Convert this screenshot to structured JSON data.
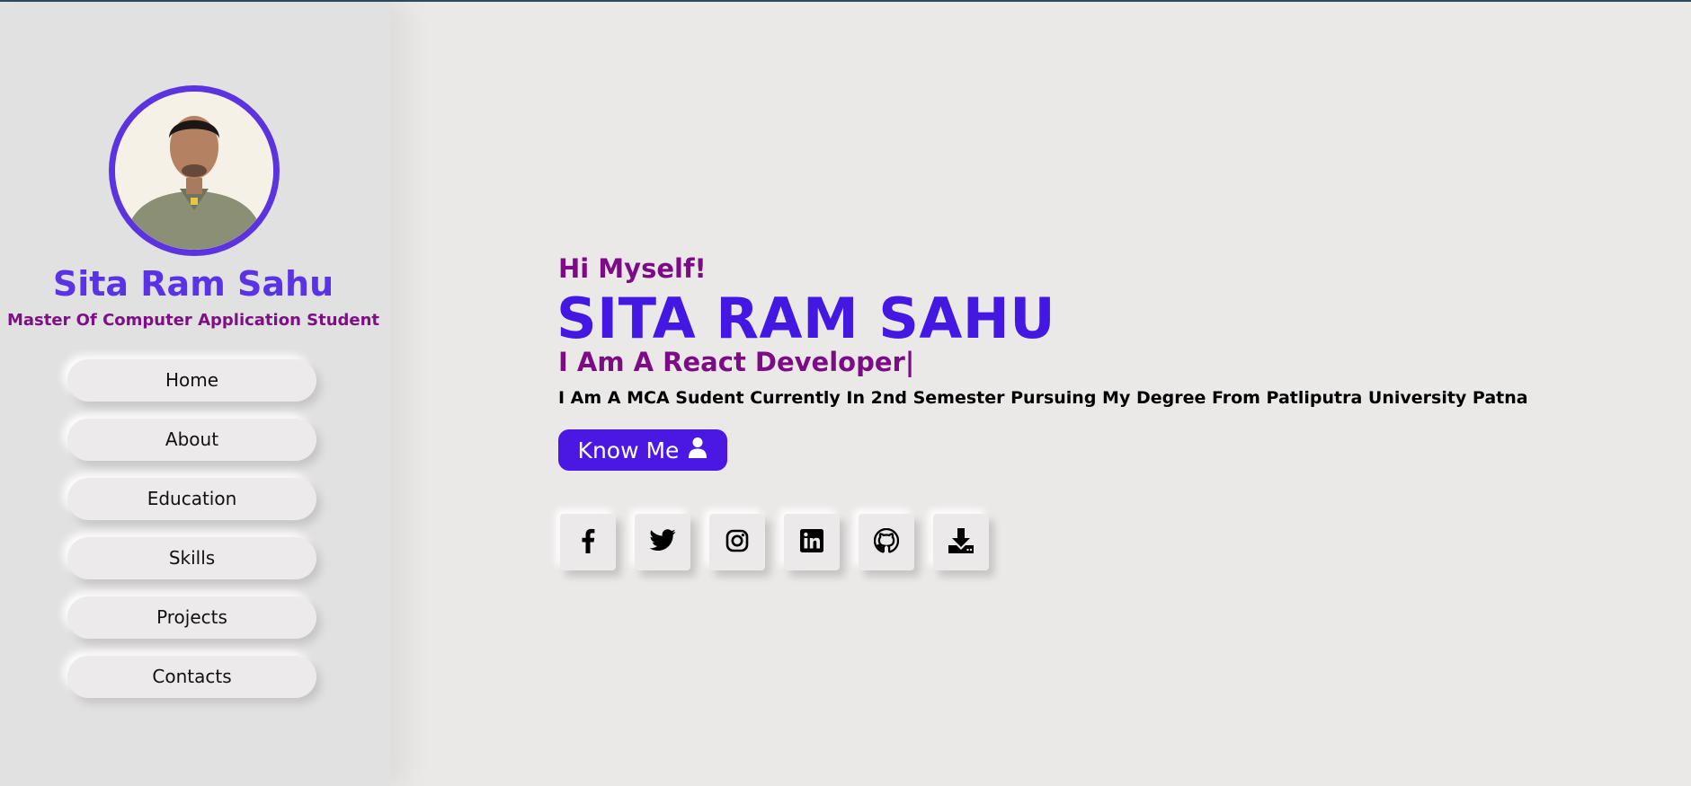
{
  "sidebar": {
    "name": "Sita Ram Sahu",
    "role": "Master Of Computer Application Student",
    "nav": [
      {
        "label": "Home"
      },
      {
        "label": "About"
      },
      {
        "label": "Education"
      },
      {
        "label": "Skills"
      },
      {
        "label": "Projects"
      },
      {
        "label": "Contacts"
      }
    ]
  },
  "hero": {
    "greeting": "Hi Myself!",
    "name": "SITA RAM SAHU",
    "role_text": "I Am A React Developer|",
    "description": "I Am A MCA Sudent Currently In 2nd Semester Pursuing My Degree From Patliputra University Patna",
    "cta_label": "Know Me",
    "cta_icon": "user-icon"
  },
  "socials": [
    {
      "icon": "facebook-icon"
    },
    {
      "icon": "twitter-icon"
    },
    {
      "icon": "instagram-icon"
    },
    {
      "icon": "linkedin-icon"
    },
    {
      "icon": "github-icon"
    },
    {
      "icon": "download-icon"
    }
  ],
  "colors": {
    "accent_purple": "#4a18e2",
    "name_purple": "#5a33e6",
    "magenta": "#7d0b86",
    "background": "#ebe9e8",
    "sidebar_bg": "#e2e1e2"
  }
}
